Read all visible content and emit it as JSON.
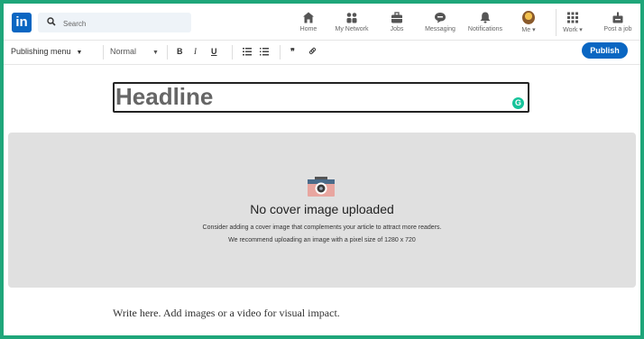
{
  "nav": {
    "search_placeholder": "Search",
    "items": [
      {
        "label": "Home",
        "icon": "home-icon"
      },
      {
        "label": "My Network",
        "icon": "network-icon"
      },
      {
        "label": "Jobs",
        "icon": "briefcase-icon"
      },
      {
        "label": "Messaging",
        "icon": "messaging-icon"
      },
      {
        "label": "Notifications",
        "icon": "bell-icon"
      },
      {
        "label": "Me ▾",
        "icon": "avatar"
      },
      {
        "label": "Work ▾",
        "icon": "grid-icon"
      },
      {
        "label": "Post a job",
        "icon": "post-job-icon"
      }
    ],
    "logo_text": "in"
  },
  "toolbar": {
    "publishing_menu": "Publishing menu",
    "style": "Normal",
    "bold": "B",
    "italic": "I",
    "underline": "U",
    "quote": "❞",
    "link": "🔗",
    "publish": "Publish"
  },
  "editor": {
    "headline_placeholder": "Headline",
    "cover_title": "No cover image uploaded",
    "cover_line1": "Consider adding a cover image that complements your article to attract more readers.",
    "cover_line2": "We recommend uploading an image with a pixel size of 1280 x 720",
    "body_placeholder": "Write here. Add images or a video for visual impact."
  },
  "colors": {
    "brand": "#0a66c2",
    "frame": "#1fa67a",
    "cover_bg": "#e0e0e0",
    "grammarly": "#15c39a"
  }
}
